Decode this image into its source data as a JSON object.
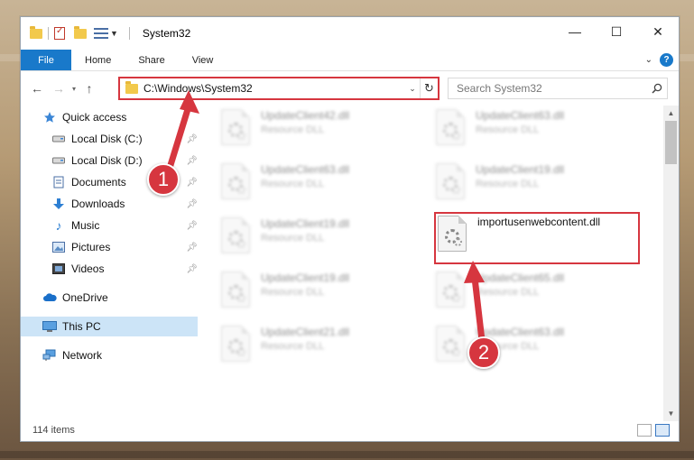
{
  "window": {
    "title": "System32"
  },
  "titlebar": {
    "minimize": "—",
    "maximize": "☐",
    "close": "✕"
  },
  "ribbon": {
    "tabs": [
      "File",
      "Home",
      "Share",
      "View"
    ]
  },
  "navbar": {
    "address": "C:\\Windows\\System32",
    "search_placeholder": "Search System32"
  },
  "sidebar": {
    "items": [
      {
        "label": "Quick access",
        "icon": "star-icon"
      },
      {
        "label": "Local Disk (C:)",
        "icon": "drive-icon",
        "pinned": true
      },
      {
        "label": "Local Disk (D:)",
        "icon": "drive-icon",
        "pinned": true
      },
      {
        "label": "Documents",
        "icon": "documents-icon",
        "pinned": true
      },
      {
        "label": "Downloads",
        "icon": "download-icon",
        "pinned": true
      },
      {
        "label": "Music",
        "icon": "music-icon",
        "pinned": true
      },
      {
        "label": "Pictures",
        "icon": "pictures-icon",
        "pinned": true
      },
      {
        "label": "Videos",
        "icon": "videos-icon",
        "pinned": true
      },
      {
        "label": "OneDrive",
        "icon": "cloud-icon"
      },
      {
        "label": "This PC",
        "icon": "computer-icon",
        "selected": true
      },
      {
        "label": "Network",
        "icon": "network-icon"
      }
    ]
  },
  "files": [
    {
      "name": "UpdateClient42.dll",
      "type": "Resource DLL"
    },
    {
      "name": "UpdateClient63.dll",
      "type": "Resource DLL"
    },
    {
      "name": "UpdateClient63.dll",
      "type": "Resource DLL"
    },
    {
      "name": "UpdateClient19.dll",
      "type": "Resource DLL"
    },
    {
      "name": "UpdateClient19.dll",
      "type": "Resource DLL"
    },
    {
      "name": "importusenwebcontent.dll",
      "type": ""
    },
    {
      "name": "UpdateClient19.dll",
      "type": "Resource DLL"
    },
    {
      "name": "UpdateClient65.dll",
      "type": "Resource DLL"
    },
    {
      "name": "UpdateClient21.dll",
      "type": "Resource DLL"
    },
    {
      "name": "UpdateClient63.dll",
      "type": "Resource DLL"
    }
  ],
  "status": {
    "item_count": "114 items"
  },
  "annotations": {
    "marker1": "1",
    "marker2": "2"
  },
  "colors": {
    "accent": "#1979ca",
    "highlight": "#d6363f"
  }
}
